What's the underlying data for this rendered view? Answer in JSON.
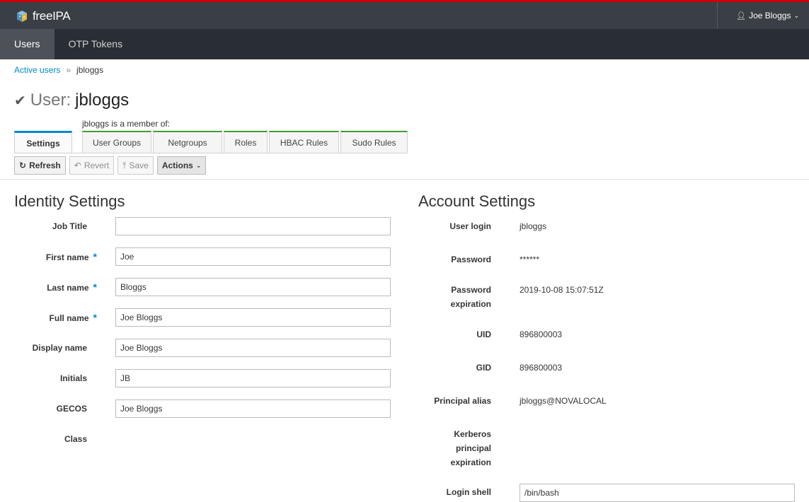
{
  "header": {
    "brand": "freeIPA",
    "user_menu": "Joe Bloggs"
  },
  "nav": {
    "items": [
      {
        "label": "Users",
        "active": true
      },
      {
        "label": "OTP Tokens",
        "active": false
      }
    ]
  },
  "breadcrumb": {
    "parent": "Active users",
    "separator": "»",
    "current": "jbloggs"
  },
  "page": {
    "title_label": "User:",
    "title_name": "jbloggs",
    "member_of": "jbloggs is a member of:"
  },
  "tabs": [
    "Settings",
    "User Groups",
    "Netgroups",
    "Roles",
    "HBAC Rules",
    "Sudo Rules"
  ],
  "toolbar": {
    "refresh": "Refresh",
    "revert": "Revert",
    "save": "Save",
    "actions": "Actions"
  },
  "identity": {
    "title": "Identity Settings",
    "fields": [
      {
        "label": "Job Title",
        "value": "",
        "required": false
      },
      {
        "label": "First name",
        "value": "Joe",
        "required": true
      },
      {
        "label": "Last name",
        "value": "Bloggs",
        "required": true
      },
      {
        "label": "Full name",
        "value": "Joe Bloggs",
        "required": true
      },
      {
        "label": "Display name",
        "value": "Joe Bloggs",
        "required": false
      },
      {
        "label": "Initials",
        "value": "JB",
        "required": false
      },
      {
        "label": "GECOS",
        "value": "Joe Bloggs",
        "required": false
      },
      {
        "label": "Class",
        "value": "",
        "required": false
      }
    ],
    "required_mark": "*"
  },
  "account": {
    "title": "Account Settings",
    "fields": [
      {
        "label": "User login",
        "value": "jbloggs"
      },
      {
        "label": "Password",
        "value": "******"
      },
      {
        "label": "Password expiration",
        "value": "2019-10-08 15:07:51Z"
      },
      {
        "label": "UID",
        "value": "896800003"
      },
      {
        "label": "GID",
        "value": "896800003"
      },
      {
        "label": "Principal alias",
        "value": "jbloggs@NOVALOCAL"
      },
      {
        "label": "Kerberos principal expiration",
        "value": ""
      },
      {
        "label": "Login shell",
        "value": "/bin/bash"
      }
    ]
  },
  "colors": {
    "accent": "#0088ce",
    "topbar": "#393f45",
    "navbar": "#292e34",
    "tab_green": "#3f9c35",
    "top_stripe": "#cc0000"
  }
}
